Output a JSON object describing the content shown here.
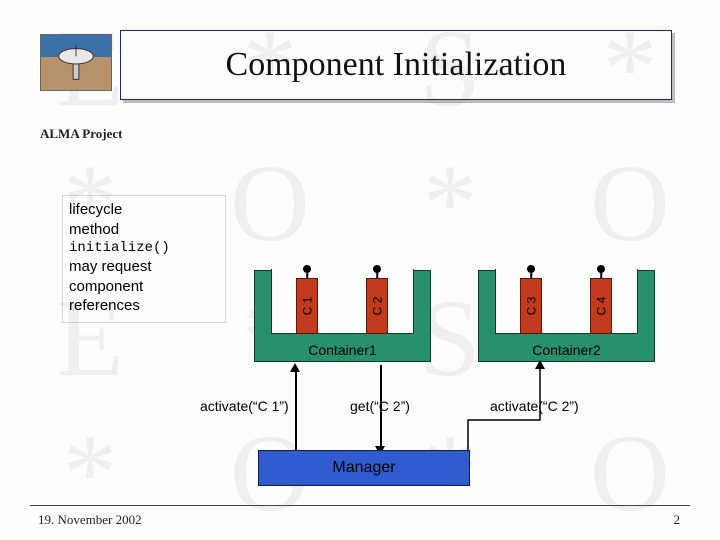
{
  "title": "Component Initialization",
  "project_label": "ALMA Project",
  "note": {
    "line1": "lifecycle",
    "line2": "method",
    "code": "initialize()",
    "line3": "may request",
    "line4": "component",
    "line5": "references"
  },
  "containers": [
    {
      "name": "Container1",
      "components": [
        "C 1",
        "C 2"
      ]
    },
    {
      "name": "Container2",
      "components": [
        "C 3",
        "C 4"
      ]
    }
  ],
  "arrows": {
    "activate1": "activate(“C 1”)",
    "get": "get(“C 2”)",
    "activate2": "activate(“C 2”)"
  },
  "manager_label": "Manager",
  "footer": {
    "date": "19. November 2002",
    "page": "2"
  }
}
